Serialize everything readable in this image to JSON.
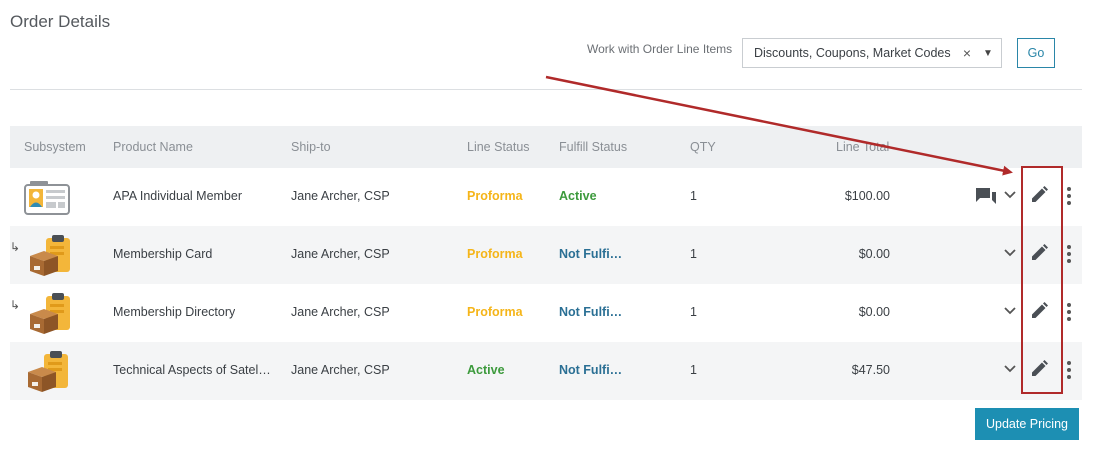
{
  "page": {
    "title": "Order Details"
  },
  "toolbar": {
    "work_label": "Work with Order Line Items",
    "select_value": "Discounts, Coupons, Market Codes",
    "clear_glyph": "×",
    "caret_glyph": "▼",
    "go_label": "Go"
  },
  "table": {
    "headers": {
      "subsystem": "Subsystem",
      "product_name": "Product Name",
      "ship_to": "Ship-to",
      "line_status": "Line Status",
      "fulfill_status": "Fulfill Status",
      "qty": "QTY",
      "line_total": "Line Total"
    },
    "rows": [
      {
        "icon": "membership-badge-icon",
        "child": false,
        "product_name": "APA Individual Member",
        "ship_to": "Jane Archer, CSP",
        "line_status": "Proforma",
        "fulfill_status": "Active",
        "qty": "1",
        "line_total": "$100.00",
        "has_chat": true
      },
      {
        "icon": "clipboard-box-icon",
        "child": true,
        "product_name": "Membership Card",
        "ship_to": "Jane Archer, CSP",
        "line_status": "Proforma",
        "fulfill_status": "Not Fulfi…",
        "qty": "1",
        "line_total": "$0.00",
        "has_chat": false
      },
      {
        "icon": "clipboard-box-icon",
        "child": true,
        "product_name": "Membership Directory",
        "ship_to": "Jane Archer, CSP",
        "line_status": "Proforma",
        "fulfill_status": "Not Fulfi…",
        "qty": "1",
        "line_total": "$0.00",
        "has_chat": false
      },
      {
        "icon": "clipboard-box-icon",
        "child": false,
        "product_name": "Technical Aspects of Satel…",
        "ship_to": "Jane Archer, CSP",
        "line_status": "Active",
        "fulfill_status": "Not Fulfi…",
        "qty": "1",
        "line_total": "$47.50",
        "has_chat": false
      }
    ]
  },
  "child_arrow_glyph": "↳",
  "footer": {
    "update_pricing_label": "Update Pricing"
  },
  "colors": {
    "proforma": "#f5b519",
    "active": "#3c9a3c",
    "not_fulfilled": "#2a6f94",
    "accent": "#1d8fb3",
    "annotation": "#b02a2a"
  }
}
